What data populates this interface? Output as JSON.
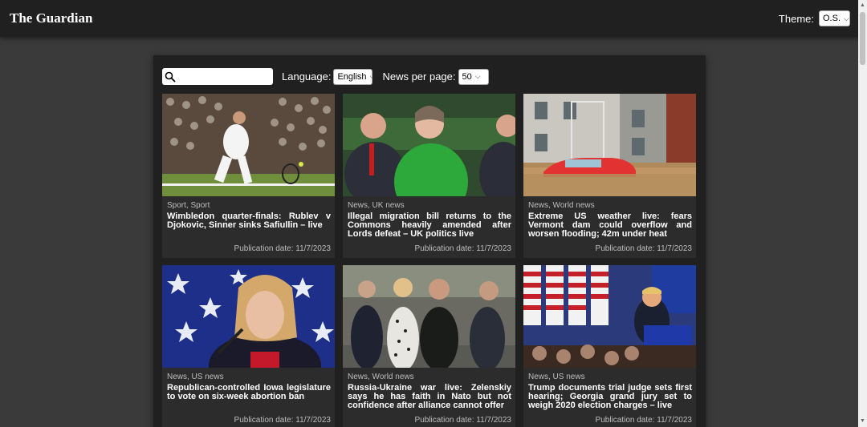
{
  "header": {
    "brand": "The Guardian",
    "theme_label": "Theme:",
    "theme_value": "O.S."
  },
  "controls": {
    "search_placeholder": "",
    "language_label": "Language:",
    "language_value": "English",
    "per_page_label": "News per page:",
    "per_page_value": "50"
  },
  "articles": [
    {
      "tags": "Sport, Sport",
      "title": "Wimbledon quarter-finals: Rublev v Djokovic, Sinner sinks Safiullin – live",
      "date": "Publication date: 11/7/2023",
      "image": "tennis-player-photo"
    },
    {
      "tags": "News, UK news",
      "title": "Illegal migration bill returns to the Commons heavily amended after Lords defeat – UK politics live",
      "date": "Publication date: 11/7/2023",
      "image": "parliament-photo"
    },
    {
      "tags": "News, World news",
      "title": "Extreme US weather live: fears Vermont dam could overflow and worsen flooding; 42m under heat",
      "date": "Publication date: 11/7/2023",
      "image": "flooded-street-photo"
    },
    {
      "tags": "News, US news",
      "title": "Republican-controlled Iowa legislature to vote on six-week abortion ban",
      "date": "Publication date: 11/7/2023",
      "image": "politician-speaking-photo"
    },
    {
      "tags": "News, World news",
      "title": "Russia-Ukraine war live: Zelenskiy says he has faith in Nato but not confidence after alliance cannot offer",
      "date": "Publication date: 11/7/2023",
      "image": "zelenskiy-walking-photo"
    },
    {
      "tags": "News, US news",
      "title": "Trump documents trial judge sets first hearing; Georgia grand jury set to weigh 2020 election charges – live",
      "date": "Publication date: 11/7/2023",
      "image": "trump-rally-photo"
    }
  ],
  "colors": {
    "background": "#3a3a3a",
    "topbar": "#202020",
    "panel": "#202020",
    "card": "#2c2c2c"
  }
}
